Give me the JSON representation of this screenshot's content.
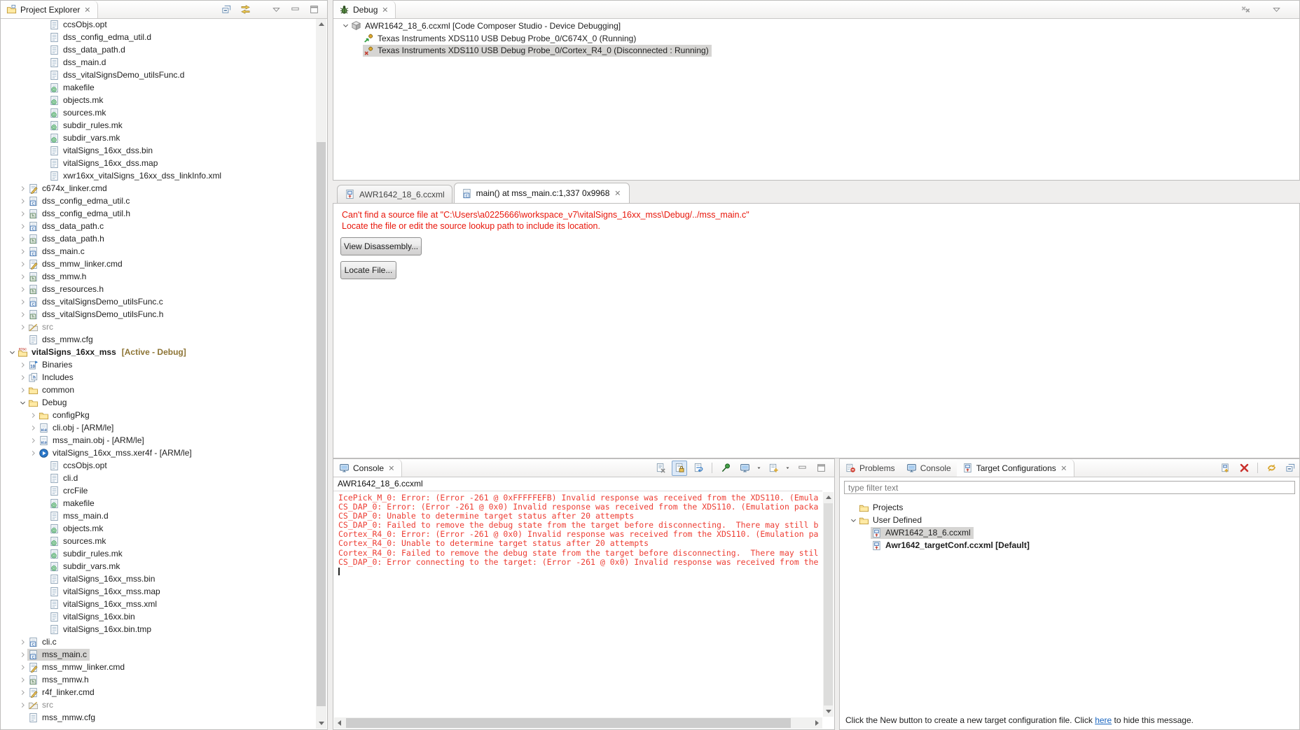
{
  "colors": {
    "selection": "#d6d5d3",
    "editor_error": "#e8170b",
    "console_error": "#ed3d33",
    "decoration": "#8d7435",
    "link": "#1a66c0"
  },
  "projectExplorer": {
    "title": "Project Explorer",
    "toolbar": [
      "collapse-all",
      "link-editor",
      "gap",
      "view-menu",
      "minimize",
      "maximize"
    ],
    "items": [
      {
        "label": "ccsObjs.opt",
        "icon": "file",
        "depth": 3,
        "arrow": "none"
      },
      {
        "label": "dss_config_edma_util.d",
        "icon": "file",
        "depth": 3,
        "arrow": "none"
      },
      {
        "label": "dss_data_path.d",
        "icon": "file",
        "depth": 3,
        "arrow": "none"
      },
      {
        "label": "dss_main.d",
        "icon": "file",
        "depth": 3,
        "arrow": "none"
      },
      {
        "label": "dss_vitalSignsDemo_utilsFunc.d",
        "icon": "file",
        "depth": 3,
        "arrow": "none"
      },
      {
        "label": "makefile",
        "icon": "file-mk",
        "depth": 3,
        "arrow": "none"
      },
      {
        "label": "objects.mk",
        "icon": "file-mk",
        "depth": 3,
        "arrow": "none"
      },
      {
        "label": "sources.mk",
        "icon": "file-mk",
        "depth": 3,
        "arrow": "none"
      },
      {
        "label": "subdir_rules.mk",
        "icon": "file-mk",
        "depth": 3,
        "arrow": "none"
      },
      {
        "label": "subdir_vars.mk",
        "icon": "file-mk",
        "depth": 3,
        "arrow": "none"
      },
      {
        "label": "vitalSigns_16xx_dss.bin",
        "icon": "file",
        "depth": 3,
        "arrow": "none"
      },
      {
        "label": "vitalSigns_16xx_dss.map",
        "icon": "file",
        "depth": 3,
        "arrow": "none"
      },
      {
        "label": "xwr16xx_vitalSigns_16xx_dss_linkInfo.xml",
        "icon": "file",
        "depth": 3,
        "arrow": "none"
      },
      {
        "label": "c674x_linker.cmd",
        "icon": "file-cmd",
        "depth": 1,
        "arrow": "collapsed"
      },
      {
        "label": "dss_config_edma_util.c",
        "icon": "file-c",
        "depth": 1,
        "arrow": "collapsed"
      },
      {
        "label": "dss_config_edma_util.h",
        "icon": "file-h",
        "depth": 1,
        "arrow": "collapsed"
      },
      {
        "label": "dss_data_path.c",
        "icon": "file-c",
        "depth": 1,
        "arrow": "collapsed"
      },
      {
        "label": "dss_data_path.h",
        "icon": "file-h",
        "depth": 1,
        "arrow": "collapsed"
      },
      {
        "label": "dss_main.c",
        "icon": "file-c",
        "depth": 1,
        "arrow": "collapsed"
      },
      {
        "label": "dss_mmw_linker.cmd",
        "icon": "file-cmd",
        "depth": 1,
        "arrow": "collapsed"
      },
      {
        "label": "dss_mmw.h",
        "icon": "file-h",
        "depth": 1,
        "arrow": "collapsed"
      },
      {
        "label": "dss_resources.h",
        "icon": "file-h",
        "depth": 1,
        "arrow": "collapsed"
      },
      {
        "label": "dss_vitalSignsDemo_utilsFunc.c",
        "icon": "file-c",
        "depth": 1,
        "arrow": "collapsed"
      },
      {
        "label": "dss_vitalSignsDemo_utilsFunc.h",
        "icon": "file-h",
        "depth": 1,
        "arrow": "collapsed"
      },
      {
        "label": "src",
        "icon": "folder-gray",
        "depth": 1,
        "arrow": "collapsed",
        "gray": true
      },
      {
        "label": "dss_mmw.cfg",
        "icon": "file",
        "depth": 1,
        "arrow": "none"
      },
      {
        "label": "vitalSigns_16xx_mss",
        "suffix": "[Active - Debug]",
        "icon": "rtsc-project",
        "depth": 0,
        "arrow": "expanded",
        "bold": true
      },
      {
        "label": "Binaries",
        "icon": "binaries",
        "depth": 1,
        "arrow": "collapsed"
      },
      {
        "label": "Includes",
        "icon": "includes",
        "depth": 1,
        "arrow": "collapsed"
      },
      {
        "label": "common",
        "icon": "folder",
        "depth": 1,
        "arrow": "collapsed"
      },
      {
        "label": "Debug",
        "icon": "folder",
        "depth": 1,
        "arrow": "expanded"
      },
      {
        "label": "configPkg",
        "icon": "folder",
        "depth": 2,
        "arrow": "collapsed"
      },
      {
        "label": "cli.obj - [ARM/le]",
        "icon": "file-obj",
        "depth": 2,
        "arrow": "collapsed"
      },
      {
        "label": "mss_main.obj - [ARM/le]",
        "icon": "file-obj",
        "depth": 2,
        "arrow": "collapsed"
      },
      {
        "label": "vitalSigns_16xx_mss.xer4f - [ARM/le]",
        "icon": "exe",
        "depth": 2,
        "arrow": "collapsed"
      },
      {
        "label": "ccsObjs.opt",
        "icon": "file",
        "depth": 3,
        "arrow": "none"
      },
      {
        "label": "cli.d",
        "icon": "file",
        "depth": 3,
        "arrow": "none"
      },
      {
        "label": "crcFile",
        "icon": "file",
        "depth": 3,
        "arrow": "none"
      },
      {
        "label": "makefile",
        "icon": "file-mk",
        "depth": 3,
        "arrow": "none"
      },
      {
        "label": "mss_main.d",
        "icon": "file",
        "depth": 3,
        "arrow": "none"
      },
      {
        "label": "objects.mk",
        "icon": "file-mk",
        "depth": 3,
        "arrow": "none"
      },
      {
        "label": "sources.mk",
        "icon": "file-mk",
        "depth": 3,
        "arrow": "none"
      },
      {
        "label": "subdir_rules.mk",
        "icon": "file-mk",
        "depth": 3,
        "arrow": "none"
      },
      {
        "label": "subdir_vars.mk",
        "icon": "file-mk",
        "depth": 3,
        "arrow": "none"
      },
      {
        "label": "vitalSigns_16xx_mss.bin",
        "icon": "file",
        "depth": 3,
        "arrow": "none"
      },
      {
        "label": "vitalSigns_16xx_mss.map",
        "icon": "file",
        "depth": 3,
        "arrow": "none"
      },
      {
        "label": "vitalSigns_16xx_mss.xml",
        "icon": "file",
        "depth": 3,
        "arrow": "none"
      },
      {
        "label": "vitalSigns_16xx.bin",
        "icon": "file",
        "depth": 3,
        "arrow": "none"
      },
      {
        "label": "vitalSigns_16xx.bin.tmp",
        "icon": "file",
        "depth": 3,
        "arrow": "none"
      },
      {
        "label": "cli.c",
        "icon": "file-c",
        "depth": 1,
        "arrow": "collapsed"
      },
      {
        "label": "mss_main.c",
        "icon": "file-c",
        "depth": 1,
        "arrow": "collapsed",
        "sel": true
      },
      {
        "label": "mss_mmw_linker.cmd",
        "icon": "file-cmd",
        "depth": 1,
        "arrow": "collapsed"
      },
      {
        "label": "mss_mmw.h",
        "icon": "file-h",
        "depth": 1,
        "arrow": "collapsed"
      },
      {
        "label": "r4f_linker.cmd",
        "icon": "file-cmd",
        "depth": 1,
        "arrow": "collapsed"
      },
      {
        "label": "src",
        "icon": "folder-gray",
        "depth": 1,
        "arrow": "collapsed",
        "gray": true
      },
      {
        "label": "mss_mmw.cfg",
        "icon": "file",
        "depth": 1,
        "arrow": "none"
      }
    ]
  },
  "debugView": {
    "title": "Debug",
    "toolbar": [
      "remove-terminated",
      "gap",
      "view-menu"
    ],
    "rows": [
      {
        "label": "AWR1642_18_6.ccxml [Code Composer Studio - Device Debugging]",
        "icon": "launch",
        "depth": 0,
        "arrow": "expanded"
      },
      {
        "label": "Texas Instruments XDS110 USB Debug Probe_0/C674X_0 (Running)",
        "icon": "probe-run",
        "depth": 1,
        "arrow": "none"
      },
      {
        "label": "Texas Instruments XDS110 USB Debug Probe_0/Cortex_R4_0 (Disconnected : Running)",
        "icon": "probe-dis",
        "depth": 1,
        "arrow": "none",
        "sel": true
      }
    ]
  },
  "editor": {
    "tabs": [
      {
        "label": "AWR1642_18_6.ccxml",
        "icon": "ccxml",
        "active": false
      },
      {
        "label": "main() at mss_main.c:1,337 0x9968",
        "icon": "file-c",
        "active": true,
        "closable": true
      }
    ],
    "message_line1": "Can't find a source file at \"C:\\Users\\a0225666\\workspace_v7\\vitalSigns_16xx_mss\\Debug/../mss_main.c\"",
    "message_line2": "Locate the file or edit the source lookup path to include its location.",
    "view_disassembly_label": "View Disassembly...",
    "locate_file_label": "Locate File..."
  },
  "console": {
    "title": "Console",
    "toolbar": [
      "clear-console",
      "scroll-lock:on",
      "word-wrap",
      "sep",
      "pin-console",
      "display-console",
      "dd",
      "open-console",
      "dd",
      "minimize",
      "maximize"
    ],
    "source_label": "AWR1642_18_6.ccxml",
    "lines": [
      "IcePick_M_0: Error: (Error -261 @ 0xFFFFFEFB) Invalid response was received from the XDS110. (Emula",
      "CS_DAP_0: Error: (Error -261 @ 0x0) Invalid response was received from the XDS110. (Emulation packa",
      "CS_DAP_0: Unable to determine target status after 20 attempts",
      "CS_DAP_0: Failed to remove the debug state from the target before disconnecting.  There may still b",
      "Cortex_R4_0: Error: (Error -261 @ 0x0) Invalid response was received from the XDS110. (Emulation pa",
      "Cortex_R4_0: Unable to determine target status after 20 attempts",
      "Cortex_R4_0: Failed to remove the debug state from the target before disconnecting.  There may stil",
      "CS_DAP_0: Error connecting to the target: (Error -261 @ 0x0) Invalid response was received from the"
    ]
  },
  "rightPanel": {
    "tabs": [
      {
        "label": "Problems",
        "icon": "problems",
        "active": false
      },
      {
        "label": "Console",
        "icon": "monitor",
        "active": false
      },
      {
        "label": "Target Configurations",
        "icon": "ccxml",
        "active": true,
        "closable": true
      }
    ],
    "toolbar": [
      "new-target",
      "delete",
      "sep",
      "refresh",
      "collapse-all"
    ],
    "filter_text": "type filter text",
    "tree": [
      {
        "label": "Projects",
        "icon": "folder",
        "depth": 0,
        "arrow": "none"
      },
      {
        "label": "User Defined",
        "icon": "folder",
        "depth": 0,
        "arrow": "expanded"
      },
      {
        "label": "AWR1642_18_6.ccxml",
        "icon": "ccxml",
        "depth": 1,
        "arrow": "none",
        "sel": true
      },
      {
        "label": "Awr1642_targetConf.ccxml [Default]",
        "icon": "ccxml",
        "depth": 1,
        "arrow": "none",
        "bold": true
      }
    ],
    "footer_pre": "Click the New button to create a new target configuration file. Click ",
    "footer_link": "here",
    "footer_post": " to hide this message."
  }
}
